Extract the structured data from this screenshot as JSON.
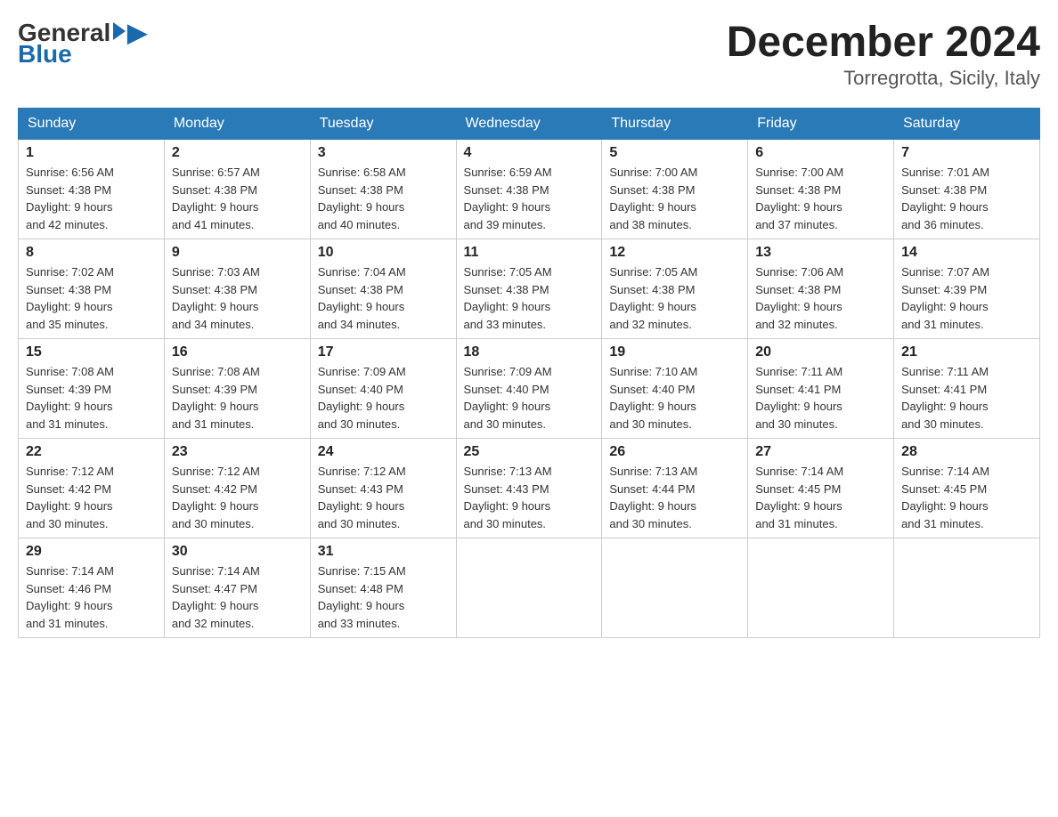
{
  "logo": {
    "general": "General",
    "blue": "Blue"
  },
  "header": {
    "month_year": "December 2024",
    "location": "Torregrotta, Sicily, Italy"
  },
  "weekdays": [
    "Sunday",
    "Monday",
    "Tuesday",
    "Wednesday",
    "Thursday",
    "Friday",
    "Saturday"
  ],
  "weeks": [
    [
      {
        "day": "1",
        "sunrise": "6:56 AM",
        "sunset": "4:38 PM",
        "daylight": "9 hours and 42 minutes."
      },
      {
        "day": "2",
        "sunrise": "6:57 AM",
        "sunset": "4:38 PM",
        "daylight": "9 hours and 41 minutes."
      },
      {
        "day": "3",
        "sunrise": "6:58 AM",
        "sunset": "4:38 PM",
        "daylight": "9 hours and 40 minutes."
      },
      {
        "day": "4",
        "sunrise": "6:59 AM",
        "sunset": "4:38 PM",
        "daylight": "9 hours and 39 minutes."
      },
      {
        "day": "5",
        "sunrise": "7:00 AM",
        "sunset": "4:38 PM",
        "daylight": "9 hours and 38 minutes."
      },
      {
        "day": "6",
        "sunrise": "7:00 AM",
        "sunset": "4:38 PM",
        "daylight": "9 hours and 37 minutes."
      },
      {
        "day": "7",
        "sunrise": "7:01 AM",
        "sunset": "4:38 PM",
        "daylight": "9 hours and 36 minutes."
      }
    ],
    [
      {
        "day": "8",
        "sunrise": "7:02 AM",
        "sunset": "4:38 PM",
        "daylight": "9 hours and 35 minutes."
      },
      {
        "day": "9",
        "sunrise": "7:03 AM",
        "sunset": "4:38 PM",
        "daylight": "9 hours and 34 minutes."
      },
      {
        "day": "10",
        "sunrise": "7:04 AM",
        "sunset": "4:38 PM",
        "daylight": "9 hours and 34 minutes."
      },
      {
        "day": "11",
        "sunrise": "7:05 AM",
        "sunset": "4:38 PM",
        "daylight": "9 hours and 33 minutes."
      },
      {
        "day": "12",
        "sunrise": "7:05 AM",
        "sunset": "4:38 PM",
        "daylight": "9 hours and 32 minutes."
      },
      {
        "day": "13",
        "sunrise": "7:06 AM",
        "sunset": "4:38 PM",
        "daylight": "9 hours and 32 minutes."
      },
      {
        "day": "14",
        "sunrise": "7:07 AM",
        "sunset": "4:39 PM",
        "daylight": "9 hours and 31 minutes."
      }
    ],
    [
      {
        "day": "15",
        "sunrise": "7:08 AM",
        "sunset": "4:39 PM",
        "daylight": "9 hours and 31 minutes."
      },
      {
        "day": "16",
        "sunrise": "7:08 AM",
        "sunset": "4:39 PM",
        "daylight": "9 hours and 31 minutes."
      },
      {
        "day": "17",
        "sunrise": "7:09 AM",
        "sunset": "4:40 PM",
        "daylight": "9 hours and 30 minutes."
      },
      {
        "day": "18",
        "sunrise": "7:09 AM",
        "sunset": "4:40 PM",
        "daylight": "9 hours and 30 minutes."
      },
      {
        "day": "19",
        "sunrise": "7:10 AM",
        "sunset": "4:40 PM",
        "daylight": "9 hours and 30 minutes."
      },
      {
        "day": "20",
        "sunrise": "7:11 AM",
        "sunset": "4:41 PM",
        "daylight": "9 hours and 30 minutes."
      },
      {
        "day": "21",
        "sunrise": "7:11 AM",
        "sunset": "4:41 PM",
        "daylight": "9 hours and 30 minutes."
      }
    ],
    [
      {
        "day": "22",
        "sunrise": "7:12 AM",
        "sunset": "4:42 PM",
        "daylight": "9 hours and 30 minutes."
      },
      {
        "day": "23",
        "sunrise": "7:12 AM",
        "sunset": "4:42 PM",
        "daylight": "9 hours and 30 minutes."
      },
      {
        "day": "24",
        "sunrise": "7:12 AM",
        "sunset": "4:43 PM",
        "daylight": "9 hours and 30 minutes."
      },
      {
        "day": "25",
        "sunrise": "7:13 AM",
        "sunset": "4:43 PM",
        "daylight": "9 hours and 30 minutes."
      },
      {
        "day": "26",
        "sunrise": "7:13 AM",
        "sunset": "4:44 PM",
        "daylight": "9 hours and 30 minutes."
      },
      {
        "day": "27",
        "sunrise": "7:14 AM",
        "sunset": "4:45 PM",
        "daylight": "9 hours and 31 minutes."
      },
      {
        "day": "28",
        "sunrise": "7:14 AM",
        "sunset": "4:45 PM",
        "daylight": "9 hours and 31 minutes."
      }
    ],
    [
      {
        "day": "29",
        "sunrise": "7:14 AM",
        "sunset": "4:46 PM",
        "daylight": "9 hours and 31 minutes."
      },
      {
        "day": "30",
        "sunrise": "7:14 AM",
        "sunset": "4:47 PM",
        "daylight": "9 hours and 32 minutes."
      },
      {
        "day": "31",
        "sunrise": "7:15 AM",
        "sunset": "4:48 PM",
        "daylight": "9 hours and 33 minutes."
      },
      null,
      null,
      null,
      null
    ]
  ],
  "labels": {
    "sunrise": "Sunrise:",
    "sunset": "Sunset:",
    "daylight": "Daylight:"
  }
}
